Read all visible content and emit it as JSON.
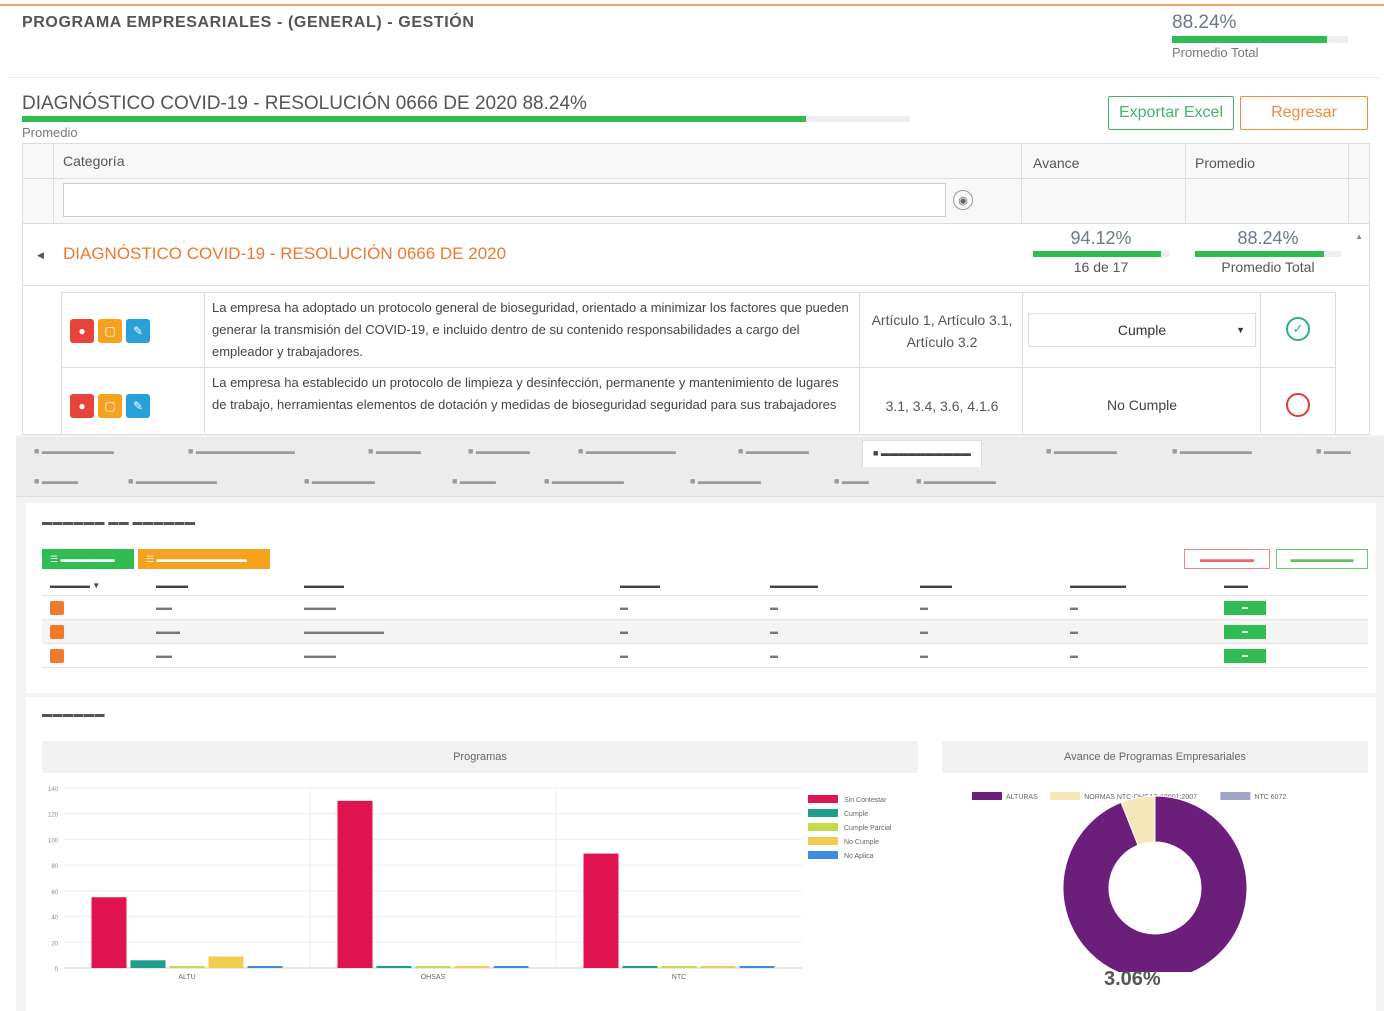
{
  "app": {
    "title": "PROGRAMA EMPRESARIALES - (GENERAL) - GESTIÓN",
    "avg_pct": "88.24%",
    "avg_label": "Promedio Total",
    "avg_fill": 0.8824
  },
  "diagnostic": {
    "title": "DIAGNÓSTICO COVID-19 - RESOLUCIÓN 0666 DE 2020 88.24%",
    "sub": "Promedio",
    "fill": 0.8824,
    "export_label": "Exportar Excel",
    "back_label": "Regresar"
  },
  "grid": {
    "col_categoria": "Categoría",
    "col_avance": "Avance",
    "col_promedio": "Promedio",
    "filter_value": "",
    "group": {
      "title": "DIAGNÓSTICO COVID-19 - RESOLUCIÓN 0666 DE 2020",
      "avance_pct": "94.12%",
      "avance_sub": "16 de 17",
      "avance_fill": 0.9412,
      "promedio_pct": "88.24%",
      "promedio_sub": "Promedio Total",
      "promedio_fill": 0.8824
    },
    "questions": [
      {
        "text": "La empresa ha adoptado un protocolo general de bioseguridad, orientado a minimizar los factores que pueden generar la transmisión del COVID-19, e incluido dentro de su contenido responsabilidades a cargo del empleador y trabajadores.",
        "articles": "Artículo 1, Artículo 3.1, Artículo 3.2",
        "status": "Cumple",
        "state_icon": "check-circle-icon"
      },
      {
        "text": "La empresa ha establecido un protocolo de limpieza y desinfección, permanente y mantenimiento de lugares de trabajo, herramientas elementos de dotación y medidas de bioseguridad seguridad para sus trabajadores",
        "articles": "3.1, 3.4, 3.6, 4.1.6",
        "status": "No Cumple",
        "state_icon": "empty-circle-icon"
      }
    ]
  },
  "colors": {
    "accent_orange": "#f0782e",
    "green": "#2fbd52",
    "red": "#e8433a",
    "purple": "#6b1f7a"
  },
  "chart_data": [
    {
      "type": "bar",
      "title": "Programas",
      "categories": [
        "ALTU",
        "OHSAS",
        "NTC"
      ],
      "ylim": [
        0,
        140
      ],
      "yticks": [
        0,
        20,
        40,
        60,
        80,
        100,
        120,
        140
      ],
      "series": [
        {
          "name": "Sin Contestar",
          "color": "#e0124f",
          "values": [
            55,
            130,
            89
          ]
        },
        {
          "name": "Cumple",
          "color": "#1f9e8d",
          "values": [
            6,
            1,
            0
          ]
        },
        {
          "name": "Cumple Parcial",
          "color": "#c5d94a",
          "values": [
            0,
            0,
            0
          ]
        },
        {
          "name": "No Cumple",
          "color": "#f0cd4f",
          "values": [
            9,
            1,
            1
          ]
        },
        {
          "name": "No Aplica",
          "color": "#3c8ee0",
          "values": [
            1,
            0,
            0
          ]
        }
      ],
      "legend": "right"
    },
    {
      "type": "pie",
      "title": "Avance de Programas Empresariales",
      "labels": [
        "ALTURAS",
        "NORMAS NTC-OHSAS 18001:2007",
        "NTC 6072"
      ],
      "values": [
        94.0,
        6.0,
        0.0
      ],
      "colors": [
        "#6b1f7a",
        "#f5e7b8",
        "#a0a7c5"
      ],
      "center_label": "3.06%",
      "legend": "top"
    }
  ]
}
